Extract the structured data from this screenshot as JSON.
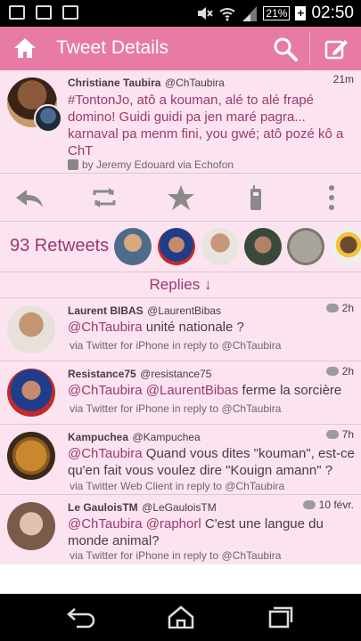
{
  "status_bar": {
    "battery": "21%",
    "time": "02:50",
    "icons": [
      "image-icon",
      "gmail-icon",
      "chat-icon",
      "mute-icon",
      "wifi-icon",
      "signal-icon",
      "battery-icon"
    ]
  },
  "action_bar": {
    "title": "Tweet Details",
    "icons": [
      "home-icon",
      "search-icon",
      "compose-icon"
    ]
  },
  "main_tweet": {
    "name": "Christiane Taubira",
    "handle": "@ChTaubira",
    "time": "21m",
    "text": "#TontonJo, atô a kouman, alé to alé frapé domino! Guidi guidi pa jen maré pagra... karnaval pa menm fini, you gwé; atô pozé kô a ChT",
    "via": "by Jeremy Edouard via Echofon"
  },
  "actions": {
    "icons": [
      "reply-icon",
      "retweet-icon",
      "favorite-icon",
      "share-icon",
      "more-icon"
    ]
  },
  "retweets": {
    "label": "93 Retweets"
  },
  "replies_header": "Replies ↓",
  "replies": [
    {
      "name": "Laurent BIBAS",
      "handle": "@LaurentBibas",
      "time": "2h",
      "mention": "@ChTaubira",
      "text": " unité nationale ?",
      "via": "via Twitter for iPhone in reply to @ChTaubira"
    },
    {
      "name": "Resistance75",
      "handle": "@resistance75",
      "time": "2h",
      "mention": "@ChTaubira @LaurentBibas",
      "text": " ferme la sorcière",
      "via": "via Twitter for iPhone in reply to @ChTaubira"
    },
    {
      "name": "Kampuchea",
      "handle": "@Kampuchea",
      "time": "7h",
      "mention": "@ChTaubira",
      "text": " Quand vous dites \"kouman\", est-ce qu'en fait vous voulez dire \"Kouign amann\" ?",
      "via": "via Twitter Web Client in reply to @ChTaubira"
    },
    {
      "name": "Le GauloisTM",
      "handle": "@LeGauloisTM",
      "time": "10 févr.",
      "mention": "@ChTaubira @raphorl",
      "text": " C'est une langue du monde animal?",
      "via": "via Twitter for iPhone in reply to @ChTaubira"
    }
  ],
  "nav_bar": {
    "icons": [
      "back-icon",
      "home-icon",
      "recent-apps-icon"
    ]
  },
  "colors": {
    "accent": "#e87aa6",
    "background": "#fbe4ef",
    "text_pink": "#9c3773"
  }
}
